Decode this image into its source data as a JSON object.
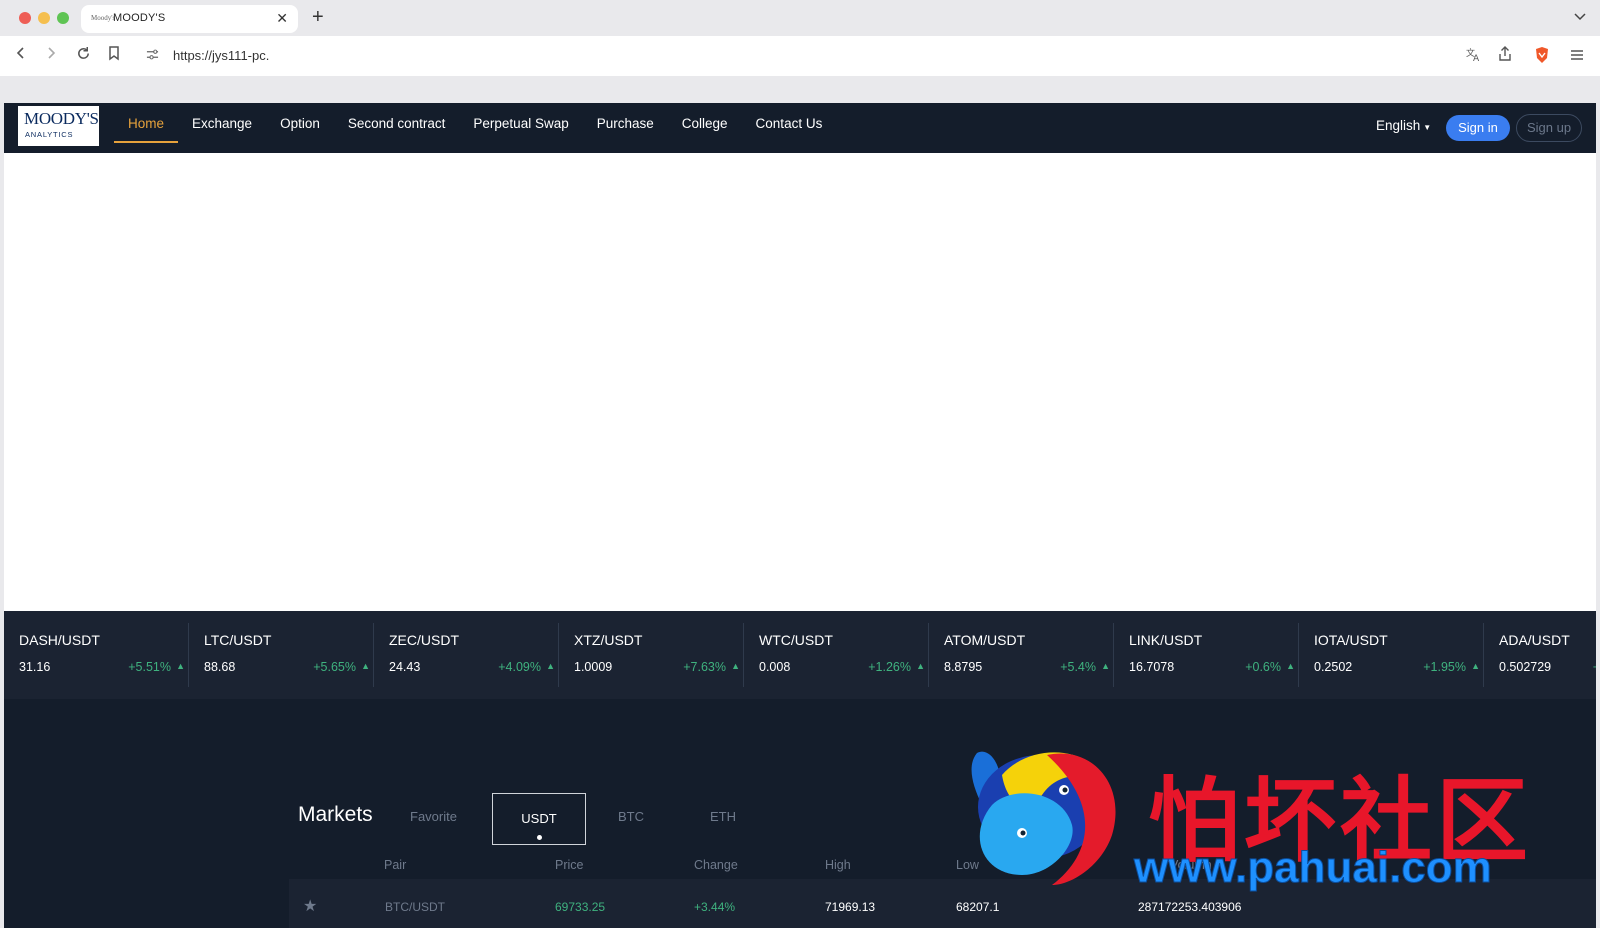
{
  "browser": {
    "tab_title": "MOODY'S",
    "tab_favicon_text": "Moody's",
    "close_glyph": "✕",
    "new_tab_glyph": "+",
    "url": "https://jys111-pc.",
    "icons": [
      "back-icon",
      "forward-icon",
      "reload-icon",
      "bookmark-icon",
      "site-settings-icon",
      "translate-icon",
      "share-icon",
      "brave-shield-icon",
      "menu-icon"
    ]
  },
  "header": {
    "logo_main": "MOODY'S",
    "logo_sub": "ANALYTICS",
    "menu": [
      {
        "label": "Home",
        "active": true
      },
      {
        "label": "Exchange"
      },
      {
        "label": "Option"
      },
      {
        "label": "Second contract"
      },
      {
        "label": "Perpetual Swap"
      },
      {
        "label": "Purchase"
      },
      {
        "label": "College"
      },
      {
        "label": "Contact Us"
      }
    ],
    "language": "English",
    "signin": "Sign in",
    "signup": "Sign up"
  },
  "ticker": [
    {
      "pair": "DASH/USDT",
      "price": "31.16",
      "change": "+5.51%"
    },
    {
      "pair": "LTC/USDT",
      "price": "88.68",
      "change": "+5.65%"
    },
    {
      "pair": "ZEC/USDT",
      "price": "24.43",
      "change": "+4.09%"
    },
    {
      "pair": "XTZ/USDT",
      "price": "1.0009",
      "change": "+7.63%"
    },
    {
      "pair": "WTC/USDT",
      "price": "0.008",
      "change": "+1.26%"
    },
    {
      "pair": "ATOM/USDT",
      "price": "8.8795",
      "change": "+5.4%"
    },
    {
      "pair": "LINK/USDT",
      "price": "16.7078",
      "change": "+0.6%"
    },
    {
      "pair": "IOTA/USDT",
      "price": "0.2502",
      "change": "+1.95%"
    },
    {
      "pair": "ADA/USDT",
      "price": "0.502729",
      "change": "+"
    }
  ],
  "markets": {
    "title": "Markets",
    "tabs": [
      "Favorite",
      "USDT",
      "BTC",
      "ETH"
    ],
    "active_tab": "USDT",
    "columns": [
      "Pair",
      "Price",
      "Change",
      "High",
      "Low",
      "Volumn"
    ],
    "rows": [
      {
        "pair": "BTC/USDT",
        "price": "69733.25",
        "change": "+3.44%",
        "high": "71969.13",
        "low": "68207.1",
        "volume": "287172253.403906"
      }
    ]
  },
  "watermark": {
    "text": "怕坏社区",
    "url": "www.pahuai.com"
  },
  "colors": {
    "nav_bg": "#141d2b",
    "ticker_bg": "#1b2332",
    "active": "#e6a23c",
    "signin": "#3a7df0",
    "up": "#3fb27f"
  }
}
